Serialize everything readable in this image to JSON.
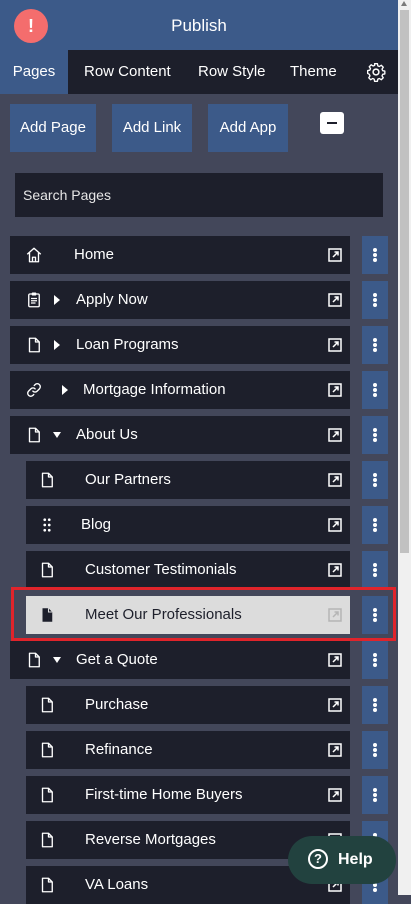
{
  "header": {
    "title": "Publish",
    "alert_glyph": "!"
  },
  "tabs": [
    {
      "label": "Pages",
      "active": true
    },
    {
      "label": "Row Content"
    },
    {
      "label": "Row Style"
    },
    {
      "label": "Theme"
    }
  ],
  "actions": {
    "add_page": "Add Page",
    "add_link": "Add Link",
    "add_app": "Add App"
  },
  "search": {
    "placeholder": "Search Pages"
  },
  "pages": [
    {
      "label": "Home",
      "icon": "home-icon"
    },
    {
      "label": "Apply Now",
      "icon": "clipboard-icon",
      "caret": "right"
    },
    {
      "label": "Loan Programs",
      "icon": "file-icon",
      "caret": "right"
    },
    {
      "label": "Mortgage Information",
      "icon": "link-icon",
      "caret": "right"
    },
    {
      "label": "About Us",
      "icon": "file-icon",
      "caret": "down"
    },
    {
      "label": "Our Partners",
      "icon": "file-icon"
    },
    {
      "label": "Blog",
      "icon": "grid-dots-icon"
    },
    {
      "label": "Customer Testimonials",
      "icon": "file-icon"
    },
    {
      "label": "Meet Our Professionals",
      "icon": "file-filled-icon",
      "selected": true
    },
    {
      "label": "Get a Quote",
      "icon": "file-icon",
      "caret": "down"
    },
    {
      "label": "Purchase",
      "icon": "file-icon"
    },
    {
      "label": "Refinance",
      "icon": "file-icon"
    },
    {
      "label": "First-time Home Buyers",
      "icon": "file-icon"
    },
    {
      "label": "Reverse Mortgages",
      "icon": "file-icon"
    },
    {
      "label": "VA Loans",
      "icon": "file-icon"
    }
  ],
  "help": {
    "label": "Help",
    "glyph": "?"
  },
  "colors": {
    "accent": "#3c5a89",
    "row_bg": "#1d1f2b",
    "panel_bg": "#43475a",
    "selected_bg": "#dcdcdc",
    "highlight": "#e0242b",
    "help_bg": "#22423f",
    "alert": "#f46d6d"
  }
}
